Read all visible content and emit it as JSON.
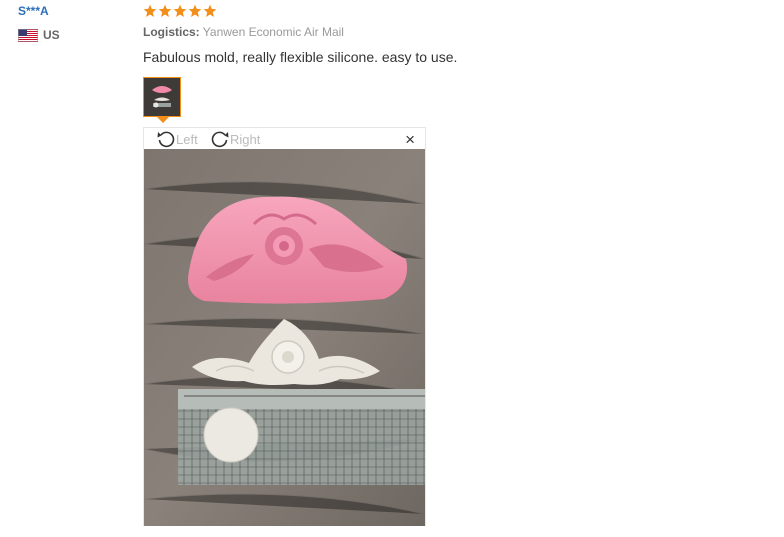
{
  "reviewer": {
    "name": "S***A",
    "country_code": "US",
    "flag_icon": "us-flag-icon"
  },
  "review": {
    "rating": 5,
    "rating_max": 5,
    "star_color": "#f28e1a",
    "logistics_label": "Logistics:",
    "logistics_value": "Yanwen Economic Air Mail",
    "text": "Fabulous mold, really flexible silicone. easy to use."
  },
  "viewer": {
    "rotate_left_label": "Left",
    "rotate_right_label": "Right",
    "close_label": "×"
  }
}
